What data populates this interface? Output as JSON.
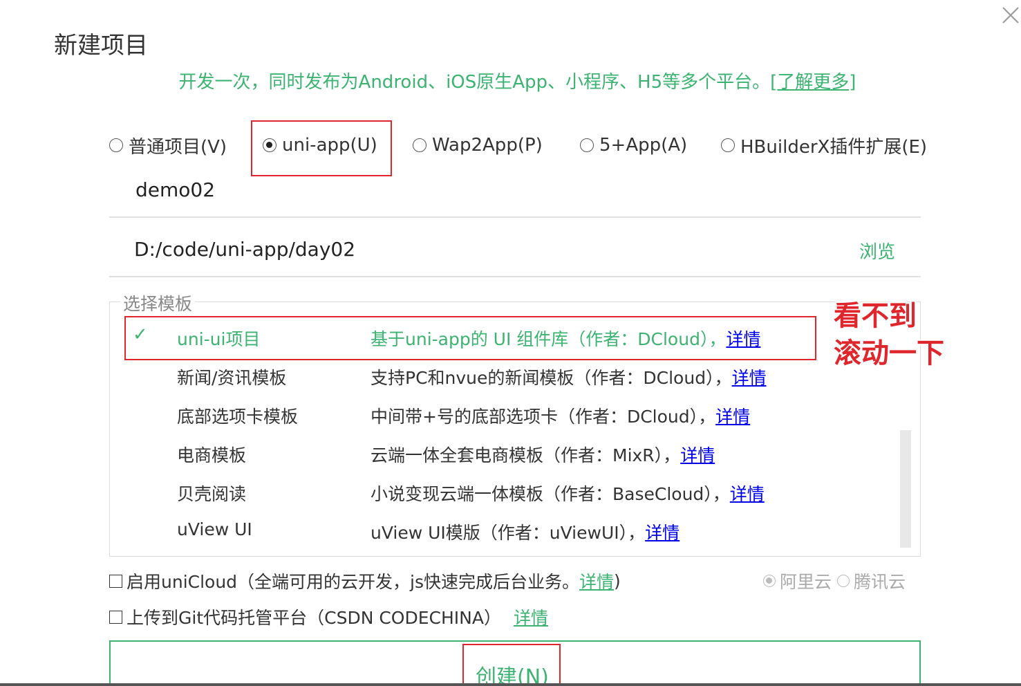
{
  "dialog": {
    "title": "新建项目",
    "subtitle": "开发一次，同时发布为Android、iOS原生App、小程序、H5等多个平台。",
    "learn_more": "[了解更多]"
  },
  "project_types": [
    {
      "label": "普通项目(V)",
      "selected": false
    },
    {
      "label": "uni-app(U)",
      "selected": true
    },
    {
      "label": "Wap2App(P)",
      "selected": false
    },
    {
      "label": "5+App(A)",
      "selected": false
    },
    {
      "label": "HBuilderX插件扩展(E)",
      "selected": false
    }
  ],
  "project_name": "demo02",
  "project_path": "D:/code/uni-app/day02",
  "browse_label": "浏览",
  "template_section": {
    "legend": "选择模板",
    "items": [
      {
        "name": "uni-ui项目",
        "desc": "基于uni-app的 UI 组件库（作者：DCloud），",
        "link": "详情",
        "selected": true
      },
      {
        "name": "新闻/资讯模板",
        "desc": "支持PC和nvue的新闻模板（作者：DCloud），",
        "link": "详情",
        "selected": false
      },
      {
        "name": "底部选项卡模板",
        "desc": "中间带+号的底部选项卡（作者：DCloud），",
        "link": "详情",
        "selected": false
      },
      {
        "name": "电商模板",
        "desc": "云端一体全套电商模板（作者：MixR），",
        "link": "详情",
        "selected": false
      },
      {
        "name": "贝壳阅读",
        "desc": "小说变现云端一体模板（作者：BaseCloud），",
        "link": "详情",
        "selected": false
      },
      {
        "name": "uView UI",
        "desc": "uView UI模版（作者：uViewUI），",
        "link": "详情",
        "selected": false
      }
    ],
    "check_mark": "✓"
  },
  "annotation": {
    "line1": "看不到",
    "line2": "滚动一下"
  },
  "unicloud": {
    "label": "启用uniCloud（全端可用的云开发，js快速完成后台业务。",
    "link": "详情",
    "close_paren": ")",
    "checked": false,
    "providers": [
      {
        "label": "阿里云",
        "selected": true
      },
      {
        "label": "腾讯云",
        "selected": false
      }
    ]
  },
  "git": {
    "label": "上传到Git代码托管平台（CSDN CODECHINA）",
    "link": "详情",
    "checked": false
  },
  "create_label": "创建(N)",
  "colors": {
    "accent_green": "#3cb371",
    "highlight_red": "#e0262d",
    "link_blue": "#0000ee"
  }
}
